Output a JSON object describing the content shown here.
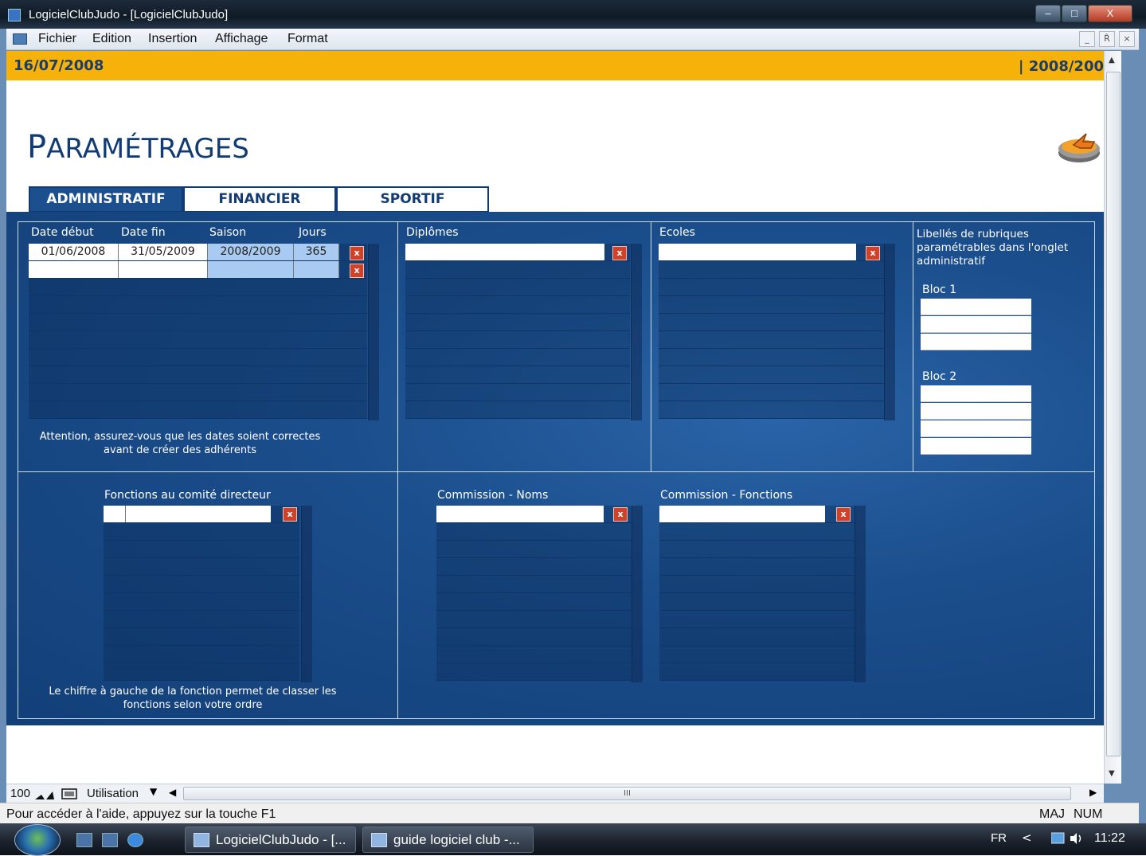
{
  "window": {
    "title": "LogicielClubJudo - [LogicielClubJudo]",
    "minimize": "–",
    "maximize": "□",
    "close": "X"
  },
  "menu": {
    "items": [
      "Fichier",
      "Edition",
      "Insertion",
      "Affichage",
      "Format"
    ],
    "mdi_min": "_",
    "mdi_restore": "Ȓ",
    "mdi_close": "×"
  },
  "header": {
    "date": "16/07/2008",
    "season": "| 2008/200"
  },
  "page": {
    "title_first": "P",
    "title_rest": "ARAMÉTRAGES"
  },
  "tabs": [
    "ADMINISTRATIF",
    "FINANCIER",
    "SPORTIF"
  ],
  "seasons": {
    "headers": [
      "Date début",
      "Date fin",
      "Saison",
      "Jours"
    ],
    "rows": [
      [
        "01/06/2008",
        "31/05/2009",
        "2008/2009",
        "365"
      ],
      [
        "",
        "",
        "",
        ""
      ]
    ],
    "note_line1": "Attention, assurez-vous que les dates soient correctes",
    "note_line2": "avant de créer des adhérents"
  },
  "diplomes": {
    "label": "Diplômes"
  },
  "ecoles": {
    "label": "Ecoles"
  },
  "libelles": {
    "label_line1": "Libellés de rubriques",
    "label_line2": "paramétrables dans l'onglet",
    "label_line3": "administratif",
    "bloc1": "Bloc 1",
    "bloc2": "Bloc 2"
  },
  "fonctions": {
    "label": "Fonctions au comité directeur",
    "note_line1": "Le chiffre à gauche de la fonction permet de classer les",
    "note_line2": "fonctions selon votre ordre"
  },
  "commission_noms": {
    "label": "Commission - Noms"
  },
  "commission_fonctions": {
    "label": "Commission - Fonctions"
  },
  "delete_glyph": "x",
  "bottombar": {
    "zoom": "100",
    "layout": "Utilisation",
    "hthumb": "III"
  },
  "statusbar": {
    "message": "Pour accéder à l'aide, appuyez sur la touche F1",
    "maj": "MAJ",
    "num": "NUM"
  },
  "taskbar": {
    "tasks": [
      "LogicielClubJudo - [...",
      "guide logiciel club -..."
    ],
    "lang": "FR",
    "arrow": "<",
    "clock": "11:22"
  },
  "colors": {
    "header": "#f7b20a",
    "panel": "#1b4e8c",
    "title": "#123b73",
    "delete": "#d1412a"
  }
}
